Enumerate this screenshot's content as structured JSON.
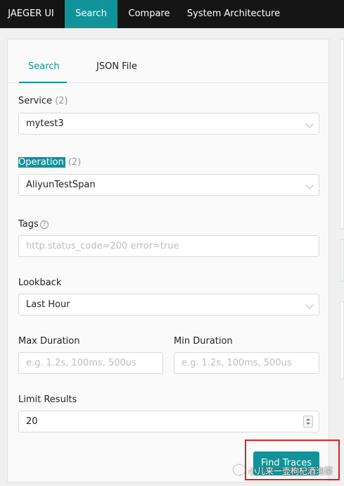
{
  "nav": {
    "brand": "JAEGER UI",
    "items": [
      "Search",
      "Compare",
      "System Architecture"
    ],
    "active": "Search"
  },
  "tabs": {
    "search": "Search",
    "json_file": "JSON File"
  },
  "service": {
    "label": "Service",
    "count": "(2)",
    "value": "mytest3"
  },
  "operation": {
    "label": "Operation",
    "count": "(2)",
    "value": "AliyunTestSpan"
  },
  "tags": {
    "label": "Tags",
    "placeholder": "http.status_code=200 error=true",
    "help_icon": "question-circle-icon"
  },
  "lookback": {
    "label": "Lookback",
    "value": "Last Hour"
  },
  "max_duration": {
    "label": "Max Duration",
    "placeholder": "e.g. 1.2s, 100ms, 500us"
  },
  "min_duration": {
    "label": "Min Duration",
    "placeholder": "e.g. 1.2s, 100ms, 500us"
  },
  "limit": {
    "label": "Limit Results",
    "value": "20"
  },
  "find_button": "Find Traces",
  "watermark": "小儿来一壶枸杞酒泡茶",
  "colors": {
    "accent": "#11939a",
    "topbar": "#151515",
    "highlight_box": "#e02020"
  }
}
